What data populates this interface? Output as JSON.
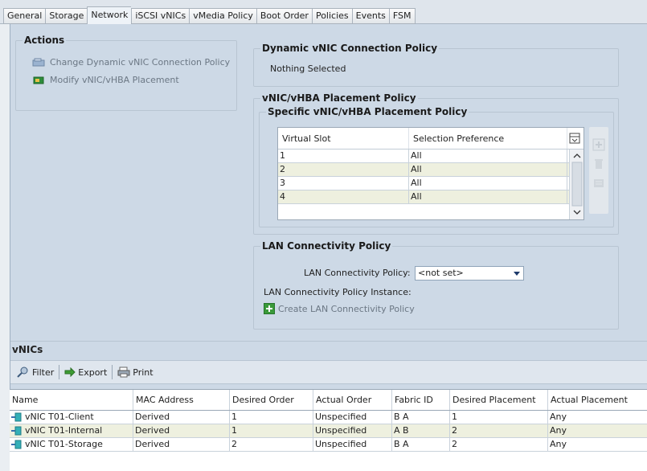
{
  "tabs": [
    "General",
    "Storage",
    "Network",
    "iSCSI vNICs",
    "vMedia Policy",
    "Boot Order",
    "Policies",
    "Events",
    "FSM"
  ],
  "active_tab_index": 2,
  "actions": {
    "title": "Actions",
    "change_dynamic": "Change Dynamic vNIC Connection Policy",
    "modify_placement": "Modify vNIC/vHBA Placement"
  },
  "dynamic_policy": {
    "title": "Dynamic vNIC Connection Policy",
    "value": "Nothing Selected"
  },
  "placement_policy": {
    "title": "vNIC/vHBA Placement Policy",
    "sub_title": "Specific vNIC/vHBA Placement Policy",
    "columns": [
      "Virtual Slot",
      "Selection Preference"
    ],
    "rows": [
      [
        "1",
        "All"
      ],
      [
        "2",
        "All"
      ],
      [
        "3",
        "All"
      ],
      [
        "4",
        "All"
      ]
    ]
  },
  "lan_policy": {
    "title": "LAN Connectivity Policy",
    "label": "LAN Connectivity Policy:",
    "selected": "<not set>",
    "instance_label": "LAN Connectivity Policy Instance:",
    "create": "Create LAN Connectivity Policy"
  },
  "vnics": {
    "title": "vNICs",
    "toolbar": {
      "filter": "Filter",
      "export": "Export",
      "print": "Print"
    },
    "columns": [
      "Name",
      "MAC Address",
      "Desired Order",
      "Actual Order",
      "Fabric ID",
      "Desired Placement",
      "Actual Placement"
    ],
    "rows": [
      [
        "vNIC T01-Client",
        "Derived",
        "1",
        "Unspecified",
        "B A",
        "1",
        "Any"
      ],
      [
        "vNIC T01-Internal",
        "Derived",
        "1",
        "Unspecified",
        "A B",
        "2",
        "Any"
      ],
      [
        "vNIC T01-Storage",
        "Derived",
        "2",
        "Unspecified",
        "B A",
        "2",
        "Any"
      ]
    ]
  }
}
